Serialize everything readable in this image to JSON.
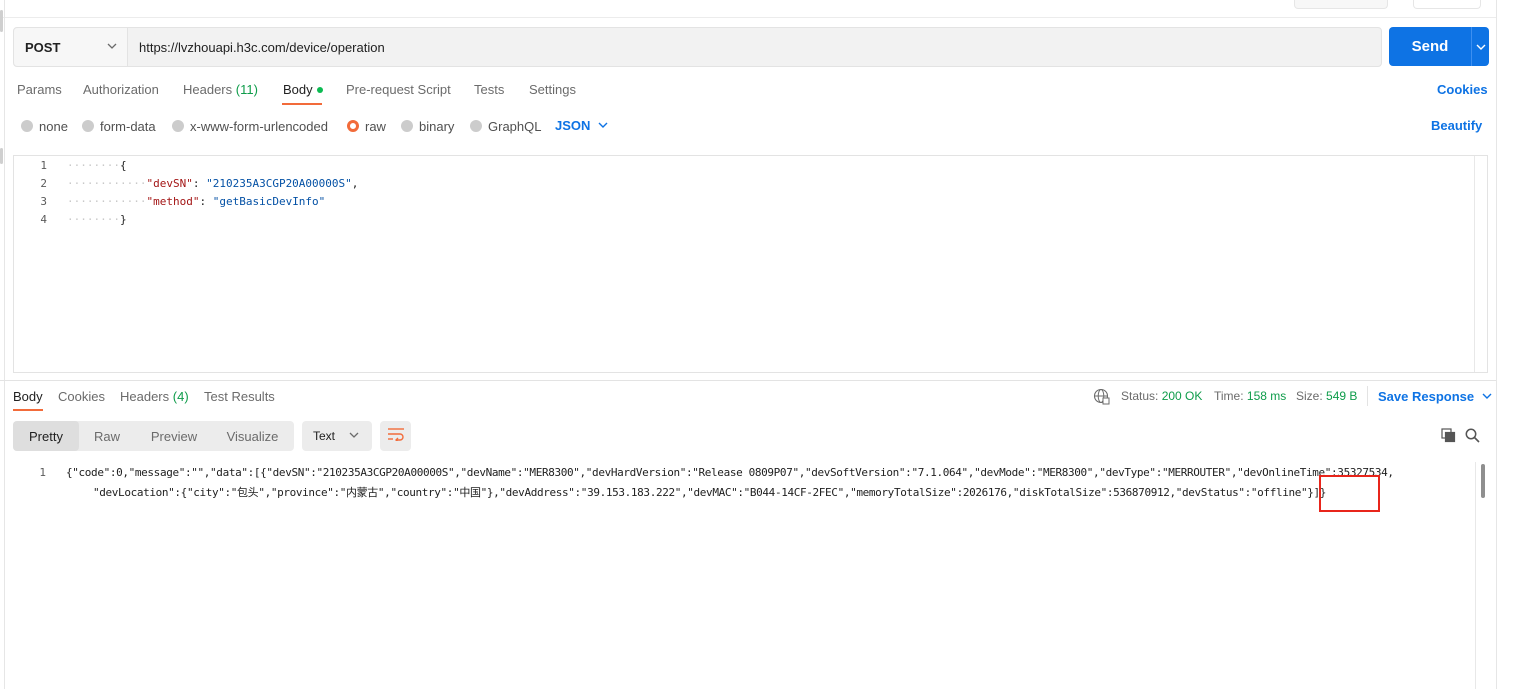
{
  "request": {
    "method": "POST",
    "url": "https://lvzhouapi.h3c.com/device/operation",
    "send_label": "Send"
  },
  "request_tabs": {
    "params": "Params",
    "authorization": "Authorization",
    "headers": "Headers",
    "headers_count": "(11)",
    "body": "Body",
    "pre_request": "Pre-request Script",
    "tests": "Tests",
    "settings": "Settings",
    "cookies": "Cookies"
  },
  "body_types": {
    "none": "none",
    "form_data": "form-data",
    "urlencoded": "x-www-form-urlencoded",
    "raw": "raw",
    "binary": "binary",
    "graphql": "GraphQL",
    "format": "JSON",
    "beautify": "Beautify",
    "selected": "raw"
  },
  "editor": {
    "line_numbers": [
      "1",
      "2",
      "3",
      "4"
    ],
    "open_brace": "{",
    "close_brace": "}",
    "key1": "\"devSN\"",
    "val1": "\"210235A3CGP20A00000S\"",
    "key2": "\"method\"",
    "val2": "\"getBasicDevInfo\""
  },
  "response_tabs": {
    "body": "Body",
    "cookies": "Cookies",
    "headers": "Headers",
    "headers_count": "(4)",
    "test_results": "Test Results"
  },
  "response_meta": {
    "status_label": "Status:",
    "status_value": "200 OK",
    "time_label": "Time:",
    "time_value": "158 ms",
    "size_label": "Size:",
    "size_value": "549 B",
    "save_response": "Save Response"
  },
  "response_toolbar": {
    "pretty": "Pretty",
    "raw": "Raw",
    "preview": "Preview",
    "visualize": "Visualize",
    "text_format": "Text",
    "active_view": "Pretty"
  },
  "response_body": {
    "line_number": "1",
    "line1": "{\"code\":0,\"message\":\"\",\"data\":[{\"devSN\":\"210235A3CGP20A00000S\",\"devName\":\"MER8300\",\"devHardVersion\":\"Release 0809P07\",\"devSoftVersion\":\"7.1.064\",\"devMode\":\"MER8300\",\"devType\":\"MERROUTER\",\"devOnlineTime\":35327534,",
    "line2": "\"devLocation\":{\"city\":\"包头\",\"province\":\"内蒙古\",\"country\":\"中国\"},\"devAddress\":\"39.153.183.222\",\"devMAC\":\"B044-14CF-2FEC\",\"memoryTotalSize\":2026176,\"diskTotalSize\":536870912,\"devStatus\":\"offline\"}]}"
  },
  "colors": {
    "accent_orange": "#f26b3a",
    "send_blue": "#0e73e4",
    "status_green": "#0e9c4a",
    "highlight_red": "#e8251b"
  }
}
